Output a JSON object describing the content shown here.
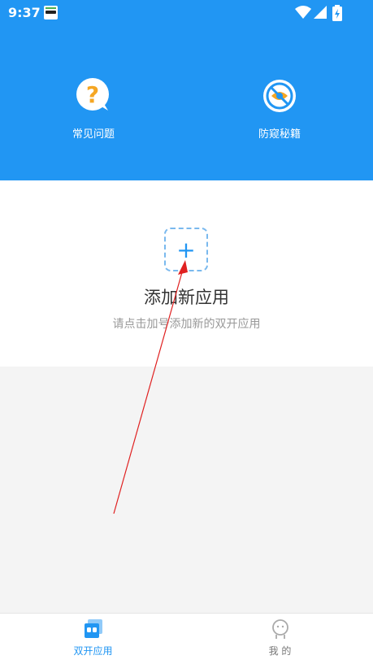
{
  "status_bar": {
    "time": "9:37"
  },
  "header": {
    "features": [
      {
        "label": "常见问题",
        "icon": "question-icon"
      },
      {
        "label": "防窥秘籍",
        "icon": "no-peek-icon"
      }
    ]
  },
  "main": {
    "add_symbol": "+",
    "title": "添加新应用",
    "hint": "请点击加号添加新的双开应用"
  },
  "tabs": [
    {
      "label": "双开应用",
      "icon": "dual-app-icon",
      "active": true
    },
    {
      "label": "我 的",
      "icon": "profile-icon",
      "active": false
    }
  ],
  "colors": {
    "primary": "#2196f3",
    "accent_orange": "#f5a623",
    "annotation_arrow": "#e02020"
  }
}
